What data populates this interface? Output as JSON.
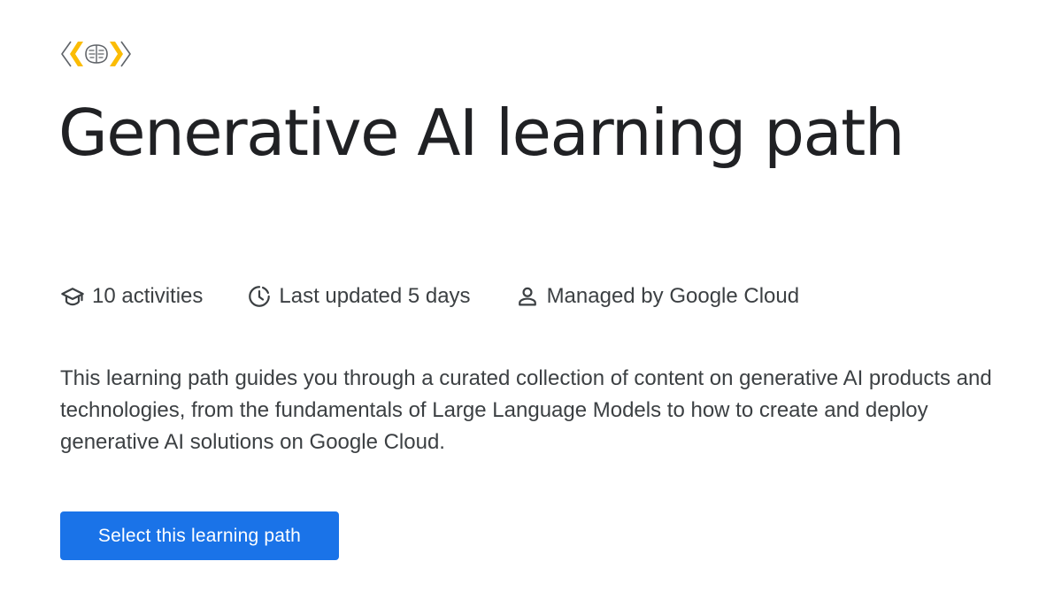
{
  "page": {
    "title": "Generative AI learning path",
    "logo_icon": "gen-ai-brain-logo-icon",
    "accent_color": "#1a73e8",
    "logo_color": "#fbbc04"
  },
  "meta": {
    "activities": {
      "icon": "graduation-cap-icon",
      "label": "10 activities"
    },
    "updated": {
      "icon": "clock-icon",
      "label": "Last updated 5 days"
    },
    "managed": {
      "icon": "person-icon",
      "label": "Managed by Google Cloud"
    }
  },
  "description": "This learning path guides you through a curated collection of content on generative AI products and technologies, from the fundamentals of Large Language Models to how to create and deploy generative AI solutions on Google Cloud.",
  "cta": {
    "label": "Select this learning path"
  }
}
